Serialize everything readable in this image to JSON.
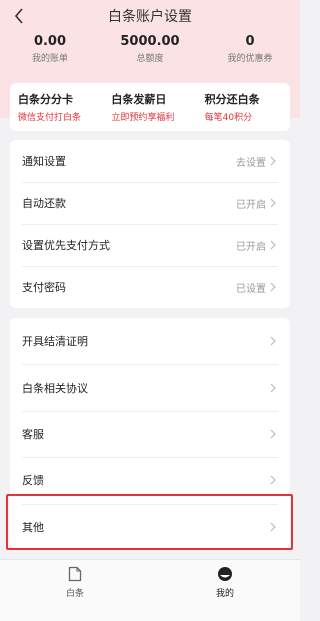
{
  "nav": {
    "title": "白条账户设置"
  },
  "stats": [
    {
      "value": "0.00",
      "label": "我的账单"
    },
    {
      "value": "5000.00",
      "label": "总额度"
    },
    {
      "value": "0",
      "label": "我的优惠券"
    }
  ],
  "promos": [
    {
      "title": "白条分分卡",
      "subtitle": "微信支付打白条"
    },
    {
      "title": "白条发薪日",
      "subtitle": "立即预约享福利"
    },
    {
      "title": "积分还白条",
      "subtitle": "每笔40积分"
    }
  ],
  "settings": [
    {
      "label": "通知设置",
      "value": "去设置"
    },
    {
      "label": "自动还款",
      "value": "已开启"
    },
    {
      "label": "设置优先支付方式",
      "value": "已开启"
    },
    {
      "label": "支付密码",
      "value": "已设置"
    }
  ],
  "more": [
    {
      "label": "开具结清证明"
    },
    {
      "label": "白条相关协议"
    },
    {
      "label": "客服"
    },
    {
      "label": "反馈"
    },
    {
      "label": "其他"
    }
  ],
  "tabs": [
    {
      "label": "白条",
      "icon": "document-icon"
    },
    {
      "label": "我的",
      "icon": "profile-icon"
    }
  ],
  "colors": {
    "accent": "#e2333a",
    "header_bg": "#fbe3e5"
  }
}
